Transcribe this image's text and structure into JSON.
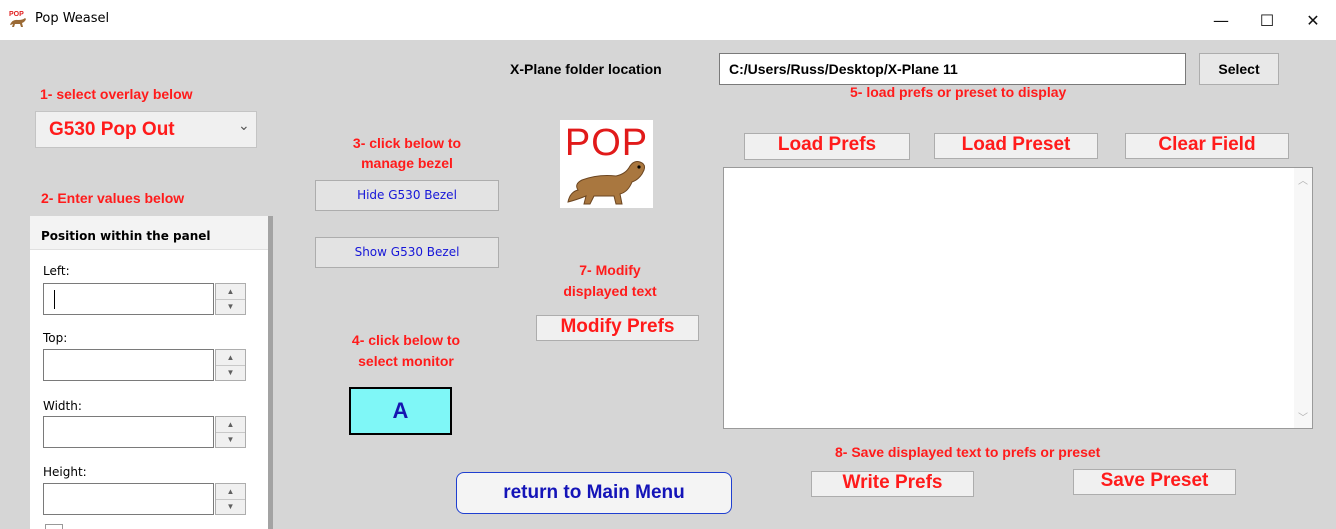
{
  "window": {
    "title": "Pop Weasel",
    "minimize_glyph": "—",
    "maximize_glyph": "☐",
    "close_glyph": "✕",
    "app_icon": "pop-weasel-icon"
  },
  "folder": {
    "label": "X-Plane folder location",
    "value": "C:/Users/Russ/Desktop/X-Plane 11",
    "select_label": "Select"
  },
  "step1": {
    "label": "1- select overlay below",
    "selected": "G530 Pop Out",
    "chevron": "⌄"
  },
  "step2": {
    "label": "2- Enter values below",
    "panel_title": "Position within the panel",
    "fields": {
      "left": "Left:",
      "top": "Top:",
      "width": "Width:",
      "height": "Height:"
    },
    "up_glyph": "▲",
    "down_glyph": "▼"
  },
  "step3": {
    "label_line1": "3- click below to",
    "label_line2": "manage bezel",
    "hide_label": "Hide G530 Bezel",
    "show_label": "Show G530 Bezel"
  },
  "step4": {
    "label_line1": "4- click below to",
    "label_line2": "select monitor",
    "monitor": "A"
  },
  "logo": {
    "text": "POP",
    "icon": "weasel-icon"
  },
  "step5": {
    "label": "5- load prefs or preset to display",
    "load_prefs": "Load Prefs",
    "load_preset": "Load Preset",
    "clear_field": "Clear Field",
    "text_value": ""
  },
  "step7": {
    "label_line1": "7- Modify",
    "label_line2": "displayed text",
    "modify_prefs": "Modify Prefs"
  },
  "step8": {
    "label": "8- Save displayed text to prefs or preset",
    "write_prefs": "Write Prefs",
    "save_preset": "Save Preset"
  },
  "main_menu": {
    "label": "return to Main Menu"
  },
  "colors": {
    "accent_red": "#ff1b1b",
    "button_blue": "#1616d8",
    "monitor_cyan": "#7ff7f7",
    "background": "#d6d6d6"
  }
}
